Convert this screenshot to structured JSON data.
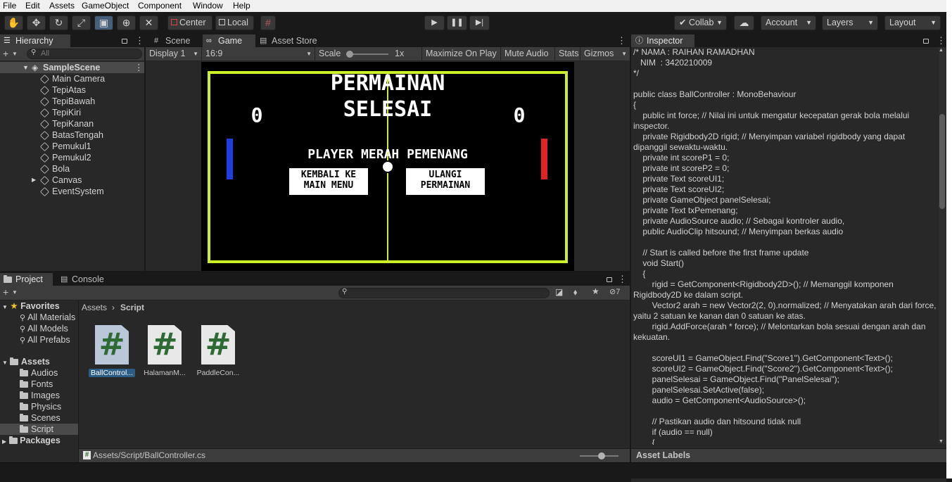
{
  "menu": [
    "File",
    "Edit",
    "Assets",
    "GameObject",
    "Component",
    "Window",
    "Help"
  ],
  "toolbar": {
    "center_label": "Center",
    "local_label": "Local",
    "collab_label": "Collab",
    "account_label": "Account",
    "layers_label": "Layers",
    "layout_label": "Layout"
  },
  "hierarchy": {
    "tab_label": "Hierarchy",
    "search_placeholder": "All",
    "scene_name": "SampleScene",
    "items": [
      "Main Camera",
      "TepiAtas",
      "TepiBawah",
      "TepiKiri",
      "TepiKanan",
      "BatasTengah",
      "Pemukul1",
      "Pemukul2",
      "Bola",
      "Canvas",
      "EventSystem"
    ]
  },
  "tabs": {
    "scene": "Scene",
    "game": "Game",
    "asset_store": "Asset Store",
    "inspector": "Inspector",
    "project": "Project",
    "console": "Console"
  },
  "gamebar": {
    "display": "Display 1",
    "aspect": "16:9",
    "scale_label": "Scale",
    "scale_value": "1x",
    "maximize": "Maximize On Play",
    "mute": "Mute Audio",
    "stats": "Stats",
    "gizmos": "Gizmos"
  },
  "game": {
    "title_line1": "PERMAINAN",
    "title_line2": "SELESAI",
    "score_left": "0",
    "score_right": "0",
    "winner_text": "PLAYER MERAH PEMENANG",
    "btn_back_line1": "KEMBALI KE",
    "btn_back_line2": "MAIN MENU",
    "btn_retry_line1": "ULANGI",
    "btn_retry_line2": "PERMAINAN",
    "colors": {
      "border": "#ccf028",
      "left_paddle": "#1f3ee0",
      "right_paddle": "#e02424"
    }
  },
  "inspector": {
    "code_lines": [
      "/* NAMA : RAIHAN RAMADHAN",
      "   NIM  : 3420210009",
      "*/",
      "",
      "public class BallController : MonoBehaviour",
      "{",
      "    public int force; // Nilai ini untuk mengatur kecepatan gerak bola melalui inspector.",
      "    private Rigidbody2D rigid; // Menyimpan variabel rigidbody yang dapat dipanggil sewaktu-waktu.",
      "    private int scoreP1 = 0;",
      "    private int scoreP2 = 0;",
      "    private Text scoreUI1;",
      "    private Text scoreUI2;",
      "    private GameObject panelSelesai;",
      "    private Text txPemenang;",
      "    private AudioSource audio; // Sebagai kontroler audio,",
      "    public AudioClip hitsound; // Menyimpan berkas audio",
      "",
      "    // Start is called before the first frame update",
      "    void Start()",
      "    {",
      "        rigid = GetComponent<Rigidbody2D>(); // Memanggil komponen Rigidbody2D ke dalam script.",
      "        Vector2 arah = new Vector2(2, 0).normalized; // Menyatakan arah dari force, yaitu 2 satuan ke kanan dan 0 satuan ke atas.",
      "        rigid.AddForce(arah * force); // Melontarkan bola sesuai dengan arah dan kekuatan.",
      "",
      "        scoreUI1 = GameObject.Find(\"Score1\").GetComponent<Text>();",
      "        scoreUI2 = GameObject.Find(\"Score2\").GetComponent<Text>();",
      "        panelSelesai = GameObject.Find(\"PanelSelesai\");",
      "        panelSelesai.SetActive(false);",
      "        audio = GetComponent<AudioSource>();",
      "",
      "        // Pastikan audio dan hitsound tidak null",
      "        if (audio == null)",
      "        {"
    ],
    "asset_labels": "Asset Labels"
  },
  "project": {
    "favorites_label": "Favorites",
    "favorites": [
      "All Materials",
      "All Models",
      "All Prefabs"
    ],
    "assets_label": "Assets",
    "folders": [
      "Audios",
      "Fonts",
      "Images",
      "Physics",
      "Scenes",
      "Script"
    ],
    "packages_label": "Packages",
    "breadcrumb_root": "Assets",
    "breadcrumb_current": "Script",
    "files": [
      "BallControl...",
      "HalamanM...",
      "PaddleCon..."
    ],
    "status_path": "Assets/Script/BallController.cs",
    "hidden_count": "7"
  }
}
